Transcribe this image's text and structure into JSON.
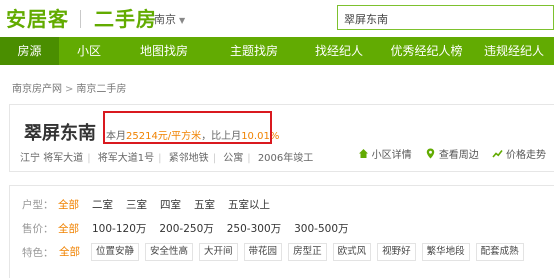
{
  "header": {
    "logo": "安居客",
    "section": "二手房",
    "city": "南京",
    "search_value": "翠屏东南"
  },
  "nav": {
    "items": [
      "房源",
      "小区",
      "地图找房",
      "主题找房",
      "找经纪人",
      "优秀经纪人榜",
      "违规经纪人"
    ]
  },
  "breadcrumb": {
    "items": [
      "南京房产网",
      "南京二手房"
    ],
    "separator": ">"
  },
  "community": {
    "name": "翠屏东南",
    "price_prefix": "本月",
    "price": "25214元/平方米",
    "compare_prefix": "，比上月",
    "compare_value": "10.01%",
    "meta": [
      "江宁",
      "将军大道",
      "将军大道1号",
      "紧邻地铁",
      "公寓",
      "2006年竣工"
    ],
    "actions": [
      "小区详情",
      "查看周边",
      "价格走势"
    ]
  },
  "filters": {
    "rows": [
      {
        "label": "户型：",
        "items": [
          "全部",
          "二室",
          "三室",
          "四室",
          "五室",
          "五室以上"
        ]
      },
      {
        "label": "售价：",
        "items": [
          "全部",
          "100-120万",
          "200-250万",
          "250-300万",
          "300-500万"
        ]
      },
      {
        "label": "特色：",
        "items": [
          "全部",
          "位置安静",
          "安全性高",
          "大开间",
          "带花园",
          "房型正",
          "欧式风",
          "视野好",
          "繁华地段",
          "配套成熟"
        ]
      }
    ]
  },
  "colors": {
    "brand_green": "#62ab02",
    "nav_active": "#4a8e00",
    "price_orange": "#f08200",
    "highlight_red": "#d9191f"
  }
}
